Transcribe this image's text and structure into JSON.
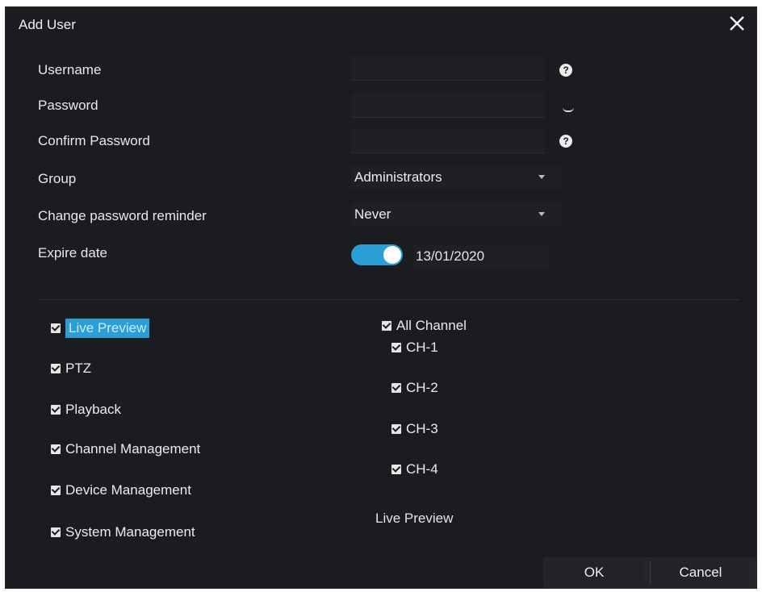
{
  "dialog": {
    "title": "Add User",
    "close_icon": "close-icon"
  },
  "form": {
    "username_label": "Username",
    "username_value": "",
    "password_label": "Password",
    "password_value": "",
    "confirm_label": "Confirm Password",
    "confirm_value": "",
    "group_label": "Group",
    "group_value": "Administrators",
    "reminder_label": "Change password reminder",
    "reminder_value": "Never",
    "expire_label": "Expire date",
    "expire_enabled": true,
    "expire_value": "13/01/2020",
    "help_symbol": "?"
  },
  "permissions": [
    {
      "label": "Live Preview",
      "checked": true,
      "selected": true
    },
    {
      "label": "PTZ",
      "checked": true
    },
    {
      "label": "Playback",
      "checked": true
    },
    {
      "label": "Channel Management",
      "checked": true
    },
    {
      "label": "Device Management",
      "checked": true
    },
    {
      "label": "System Management",
      "checked": true
    }
  ],
  "channels": {
    "all_label": "All Channel",
    "items": [
      {
        "label": "CH-1",
        "checked": true
      },
      {
        "label": "CH-2",
        "checked": true
      },
      {
        "label": "CH-3",
        "checked": true
      },
      {
        "label": "CH-4",
        "checked": true
      }
    ],
    "footer": "Live Preview"
  },
  "buttons": {
    "ok": "OK",
    "cancel": "Cancel"
  },
  "colors": {
    "background": "#1b1c20",
    "accent": "#2a9fd6",
    "text": "#e4e4e4"
  }
}
